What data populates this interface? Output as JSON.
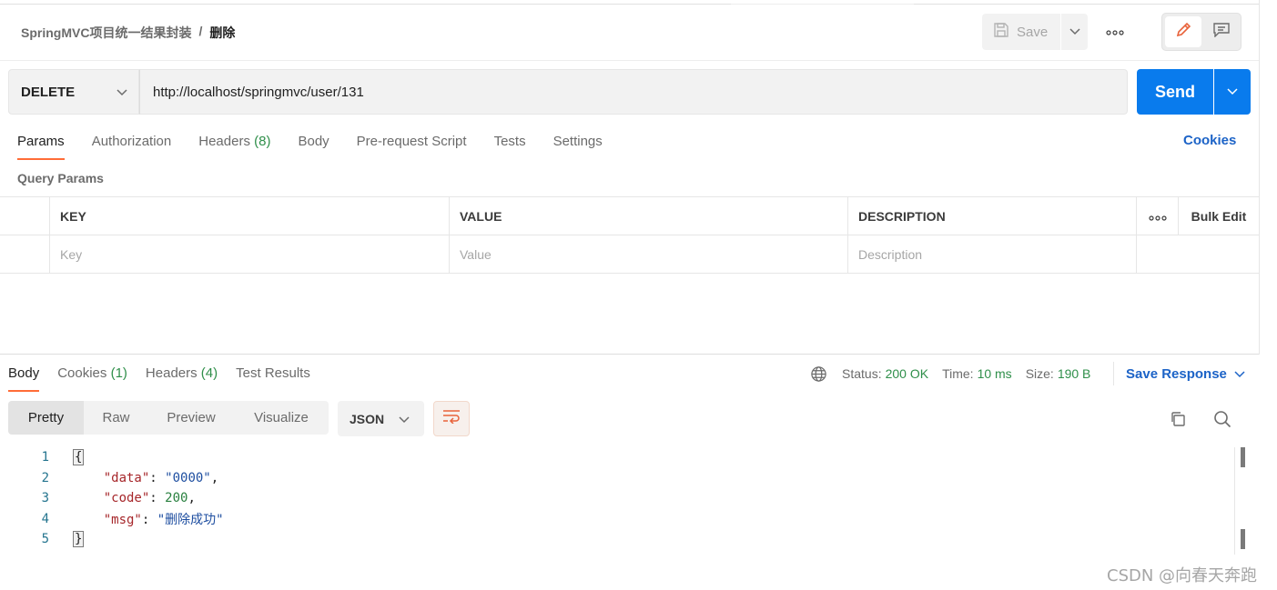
{
  "header": {
    "collection": "SpringMVC项目统一结果封装",
    "separator": "/",
    "request_name": "删除",
    "save_label": "Save"
  },
  "request": {
    "method": "DELETE",
    "url": "http://localhost/springmvc/user/131",
    "send_label": "Send"
  },
  "request_tabs": [
    {
      "label": "Params",
      "count": ""
    },
    {
      "label": "Authorization",
      "count": ""
    },
    {
      "label": "Headers",
      "count": "(8)"
    },
    {
      "label": "Body",
      "count": ""
    },
    {
      "label": "Pre-request Script",
      "count": ""
    },
    {
      "label": "Tests",
      "count": ""
    },
    {
      "label": "Settings",
      "count": ""
    }
  ],
  "cookies_link": "Cookies",
  "query_params": {
    "title": "Query Params",
    "columns": {
      "key": "KEY",
      "value": "VALUE",
      "description": "DESCRIPTION",
      "bulk_edit": "Bulk Edit"
    },
    "placeholders": {
      "key": "Key",
      "value": "Value",
      "description": "Description"
    }
  },
  "response_tabs": [
    {
      "label": "Body",
      "count": ""
    },
    {
      "label": "Cookies",
      "count": "(1)"
    },
    {
      "label": "Headers",
      "count": "(4)"
    },
    {
      "label": "Test Results",
      "count": ""
    }
  ],
  "status": {
    "status_label": "Status:",
    "status_value": "200 OK",
    "time_label": "Time:",
    "time_value": "10 ms",
    "size_label": "Size:",
    "size_value": "190 B",
    "save_response": "Save Response"
  },
  "view_modes": [
    "Pretty",
    "Raw",
    "Preview",
    "Visualize"
  ],
  "format": "JSON",
  "code_lines": [
    {
      "n": "1",
      "text": "{"
    },
    {
      "n": "2",
      "key": "\"data\"",
      "value": "\"0000\"",
      "type": "string",
      "comma": ","
    },
    {
      "n": "3",
      "key": "\"code\"",
      "value": "200",
      "type": "number",
      "comma": ","
    },
    {
      "n": "4",
      "key": "\"msg\"",
      "value": "\"删除成功\"",
      "type": "string",
      "comma": ""
    },
    {
      "n": "5",
      "text": "}"
    }
  ],
  "watermark": "CSDN @向春天奔跑",
  "colors": {
    "accent": "#ff6c37",
    "send": "#097bed",
    "link": "#1c63c7",
    "status_ok": "#2f8f4a"
  }
}
